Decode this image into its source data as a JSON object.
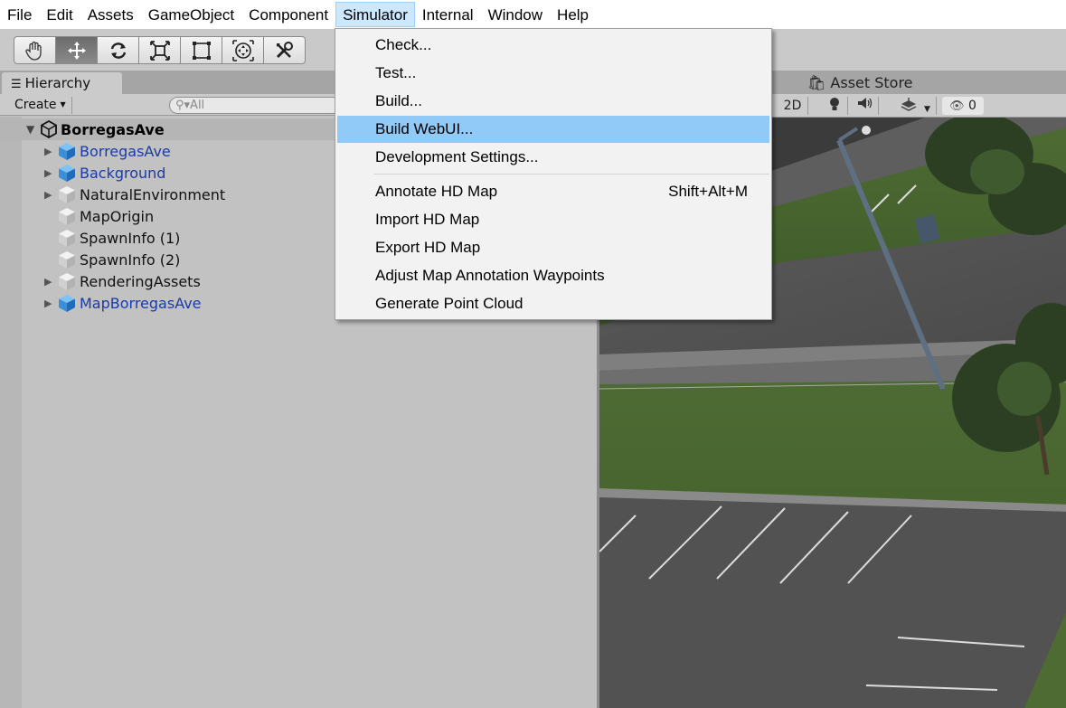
{
  "menubar": {
    "items": [
      "File",
      "Edit",
      "Assets",
      "GameObject",
      "Component",
      "Simulator",
      "Internal",
      "Window",
      "Help"
    ],
    "active_index": 5
  },
  "toolbar": {
    "tools": [
      "hand-icon",
      "move-icon",
      "rotate-icon",
      "scale-icon",
      "rect-icon",
      "transform-icon",
      "custom-tool-icon"
    ],
    "selected_index": 1
  },
  "hierarchy": {
    "tab_label": "Hierarchy",
    "create_label": "Create",
    "search_placeholder": "All",
    "scene_name": "BorregasAve",
    "rows": [
      {
        "label": "BorregasAve",
        "prefab": true,
        "expandable": true
      },
      {
        "label": "Background",
        "prefab": true,
        "expandable": true
      },
      {
        "label": "NaturalEnvironment",
        "prefab": false,
        "expandable": true
      },
      {
        "label": "MapOrigin",
        "prefab": false,
        "expandable": false
      },
      {
        "label": "SpawnInfo (1)",
        "prefab": false,
        "expandable": false
      },
      {
        "label": "SpawnInfo (2)",
        "prefab": false,
        "expandable": false
      },
      {
        "label": "RenderingAssets",
        "prefab": false,
        "expandable": true
      },
      {
        "label": "MapBorregasAve",
        "prefab": true,
        "expandable": true
      }
    ]
  },
  "scene": {
    "asset_store_label": "Asset Store",
    "mode_2d_label": "2D",
    "hidden_count": "0"
  },
  "dropdown": {
    "items": [
      {
        "label": "Check...",
        "shortcut": ""
      },
      {
        "label": "Test...",
        "shortcut": ""
      },
      {
        "label": "Build...",
        "shortcut": ""
      },
      {
        "label": "Build WebUI...",
        "shortcut": ""
      },
      {
        "label": "Development Settings...",
        "shortcut": ""
      },
      {
        "label": "Annotate HD Map",
        "shortcut": "Shift+Alt+M"
      },
      {
        "label": "Import HD Map",
        "shortcut": ""
      },
      {
        "label": "Export HD Map",
        "shortcut": ""
      },
      {
        "label": "Adjust Map Annotation Waypoints",
        "shortcut": ""
      },
      {
        "label": "Generate Point Cloud",
        "shortcut": ""
      }
    ],
    "highlight_index": 3
  },
  "colors": {
    "menu_active": "#cce8ff",
    "dropdown_highlight": "#91c9f7",
    "prefab_text": "#1a3aa8"
  }
}
